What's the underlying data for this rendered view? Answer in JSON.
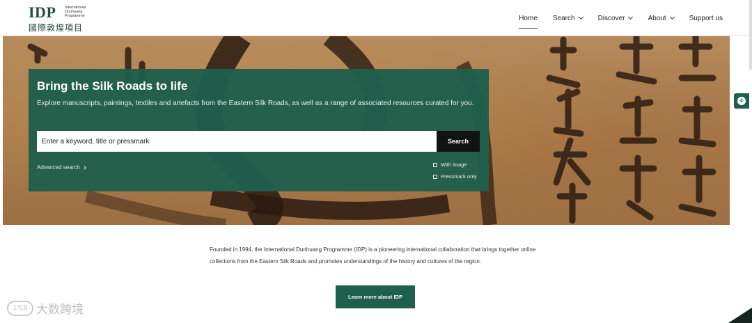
{
  "logo": {
    "mark": "IDP",
    "sub_line1": "International",
    "sub_line2": "Dunhuang",
    "sub_line3": "Programme",
    "cjk": "國際敦煌項目"
  },
  "nav": {
    "items": [
      {
        "label": "Home",
        "active": true
      },
      {
        "label": "Search",
        "has_dropdown": true
      },
      {
        "label": "Discover",
        "has_dropdown": true
      },
      {
        "label": "About",
        "has_dropdown": true
      },
      {
        "label": "Support us"
      }
    ]
  },
  "hero": {
    "title": "Bring the Silk Roads to life",
    "description": "Explore manuscripts, paintings, textiles and artefacts from the Eastern Silk Roads, as well as a range of associated resources curated for you.",
    "search_placeholder": "Enter a keyword, title or pressmark",
    "search_button": "Search",
    "advanced_search": "Advanced search",
    "filters": [
      {
        "label": "With image",
        "checked": false
      },
      {
        "label": "Pressmark only",
        "checked": false
      }
    ]
  },
  "intro": {
    "text": "Founded in 1994, the International Dunhuang Programme (IDP) is a pioneering international collaboration that brings together online collections from the Eastern Silk Roads and promotes understandings of the history and cultures of the region.",
    "cta_label": "Learn more about IDP"
  },
  "watermark": {
    "icon_text": "1℃0",
    "text": "大数跨境"
  },
  "colors": {
    "brand_green": "#1f5f4d",
    "search_button": "#101312",
    "text_dark": "#222222"
  },
  "icons": {
    "accessibility": "accessibility-icon",
    "dropdown": "chevron-down-icon",
    "advanced_search": "chevron-right-icon"
  }
}
